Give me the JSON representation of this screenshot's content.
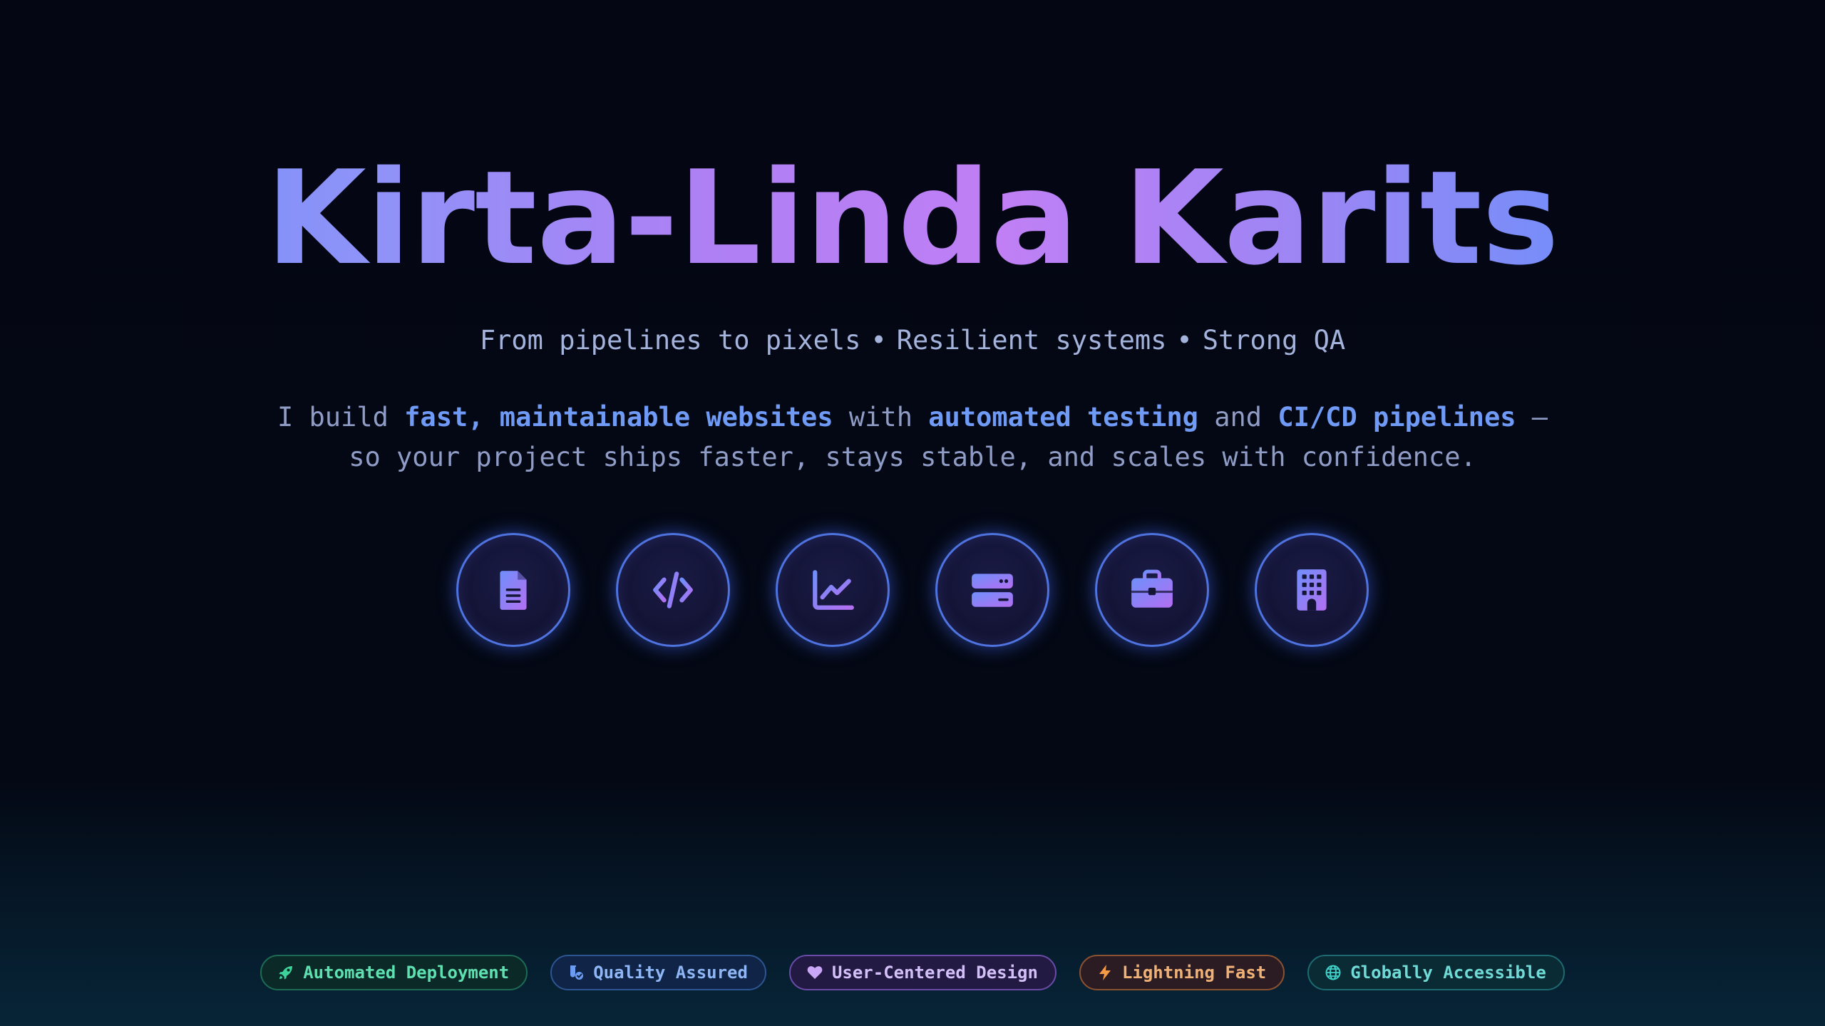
{
  "hero": {
    "title": "Kirta-Linda Karits",
    "tagline": [
      "From pipelines to pixels",
      "Resilient systems",
      "Strong QA"
    ],
    "tagline_separator": "•",
    "description": {
      "part1": "I build ",
      "highlight1": "fast, maintainable websites",
      "part2": " with ",
      "highlight2": "automated testing",
      "part3": " and ",
      "highlight3": "CI/CD pipelines",
      "part4": " —",
      "line2": "so your project ships faster, stays stable, and scales with confidence."
    }
  },
  "icons": [
    {
      "name": "document-icon"
    },
    {
      "name": "code-icon"
    },
    {
      "name": "chart-line-icon"
    },
    {
      "name": "server-icon"
    },
    {
      "name": "briefcase-icon"
    },
    {
      "name": "building-icon"
    }
  ],
  "badges": [
    {
      "label": "Automated Deployment",
      "icon": "rocket-icon",
      "color": "#5fe0b0"
    },
    {
      "label": "Quality Assured",
      "icon": "vial-check-icon",
      "color": "#8fb6f5"
    },
    {
      "label": "User-Centered Design",
      "icon": "heart-icon",
      "color": "#d3c0f8"
    },
    {
      "label": "Lightning Fast",
      "icon": "bolt-icon",
      "color": "#f0b176"
    },
    {
      "label": "Globally Accessible",
      "icon": "globe-icon",
      "color": "#6fdad6"
    }
  ],
  "colors": {
    "background": "#040713",
    "accent_blue": "#6f9af5",
    "accent_purple": "#c07ff5",
    "icon_ring": "#4f74e0"
  }
}
